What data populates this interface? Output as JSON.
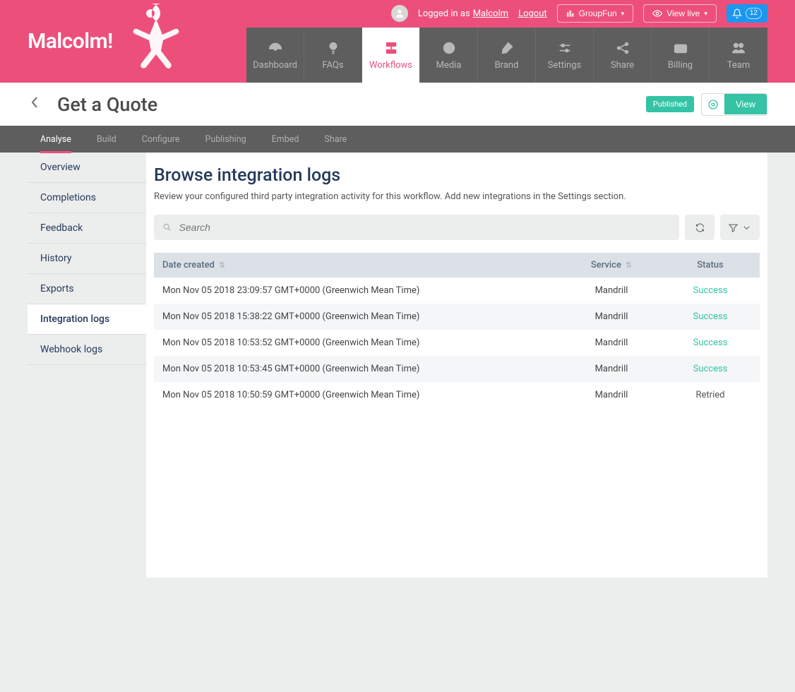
{
  "brand": {
    "name": "Malcolm!"
  },
  "user": {
    "logged_prefix": "Logged in as",
    "name": "Malcolm",
    "logout": "Logout"
  },
  "topbuttons": {
    "group": "GroupFun",
    "viewlive": "View live",
    "notif_count": "12"
  },
  "mainnav": [
    {
      "label": "Dashboard"
    },
    {
      "label": "FAQs"
    },
    {
      "label": "Workflows"
    },
    {
      "label": "Media"
    },
    {
      "label": "Brand"
    },
    {
      "label": "Settings"
    },
    {
      "label": "Share"
    },
    {
      "label": "Billing"
    },
    {
      "label": "Team"
    }
  ],
  "page": {
    "title": "Get a Quote",
    "published": "Published",
    "view": "View"
  },
  "subtabs": [
    {
      "label": "Analyse"
    },
    {
      "label": "Build"
    },
    {
      "label": "Configure"
    },
    {
      "label": "Publishing"
    },
    {
      "label": "Embed"
    },
    {
      "label": "Share"
    }
  ],
  "sidebar": [
    {
      "label": "Overview"
    },
    {
      "label": "Completions"
    },
    {
      "label": "Feedback"
    },
    {
      "label": "History"
    },
    {
      "label": "Exports"
    },
    {
      "label": "Integration logs"
    },
    {
      "label": "Webhook logs"
    }
  ],
  "main": {
    "heading": "Browse integration logs",
    "description": "Review your configured third party integration activity for this workflow. Add new integrations in the Settings section.",
    "search_placeholder": "Search"
  },
  "table": {
    "headers": {
      "date": "Date created",
      "service": "Service",
      "status": "Status"
    },
    "rows": [
      {
        "date": "Mon Nov 05 2018 23:09:57 GMT+0000 (Greenwich Mean Time)",
        "service": "Mandrill",
        "status": "Success",
        "status_class": "success"
      },
      {
        "date": "Mon Nov 05 2018 15:38:22 GMT+0000 (Greenwich Mean Time)",
        "service": "Mandrill",
        "status": "Success",
        "status_class": "success"
      },
      {
        "date": "Mon Nov 05 2018 10:53:52 GMT+0000 (Greenwich Mean Time)",
        "service": "Mandrill",
        "status": "Success",
        "status_class": "success"
      },
      {
        "date": "Mon Nov 05 2018 10:53:45 GMT+0000 (Greenwich Mean Time)",
        "service": "Mandrill",
        "status": "Success",
        "status_class": "success"
      },
      {
        "date": "Mon Nov 05 2018 10:50:59 GMT+0000 (Greenwich Mean Time)",
        "service": "Mandrill",
        "status": "Retried",
        "status_class": "retried"
      }
    ]
  }
}
